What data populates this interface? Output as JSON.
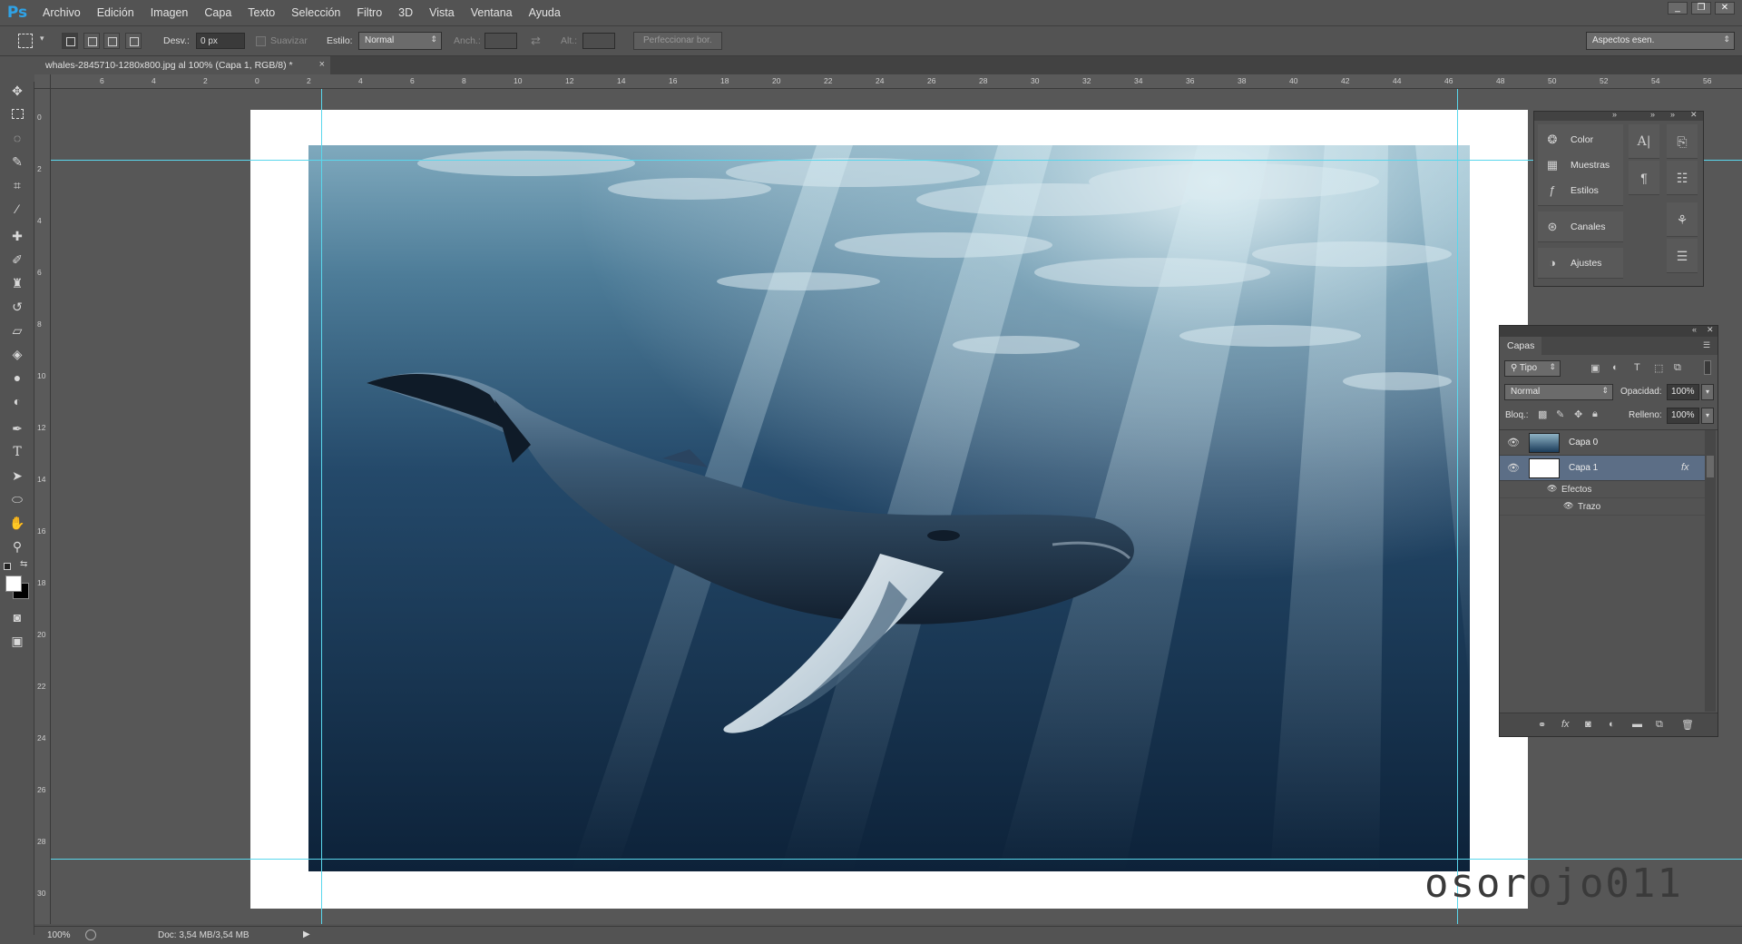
{
  "app": {
    "logo": "Ps"
  },
  "menu": [
    "Archivo",
    "Edición",
    "Imagen",
    "Capa",
    "Texto",
    "Selección",
    "Filtro",
    "3D",
    "Vista",
    "Ventana",
    "Ayuda"
  ],
  "window_controls": [
    "_",
    "❐",
    "✕"
  ],
  "options": {
    "feather_label": "Desv.:",
    "feather_value": "0 px",
    "antialias_label": "Suavizar",
    "style_label": "Estilo:",
    "style_value": "Normal",
    "width_label": "Anch.:",
    "height_label": "Alt.:",
    "refine_button": "Perfeccionar bor.",
    "workspace_value": "Aspectos esen."
  },
  "document": {
    "tab_title": "whales-2845710-1280x800.jpg al 100% (Capa 1, RGB/8) *",
    "close": "×"
  },
  "ruler_top_labels": [
    "6",
    "4",
    "2",
    "0",
    "2",
    "4",
    "6",
    "8",
    "10",
    "12",
    "14",
    "16",
    "18",
    "20",
    "22",
    "24",
    "26",
    "28",
    "30",
    "32",
    "34",
    "36",
    "38",
    "40",
    "42",
    "44",
    "46",
    "48",
    "50",
    "52",
    "54",
    "56"
  ],
  "ruler_left_labels": [
    "0",
    "2",
    "4",
    "6",
    "8",
    "10",
    "12",
    "14",
    "16",
    "18",
    "20",
    "22",
    "24",
    "26",
    "28",
    "30"
  ],
  "watermark": "osorojo011",
  "status": {
    "zoom": "100%",
    "doc_info": "Doc: 3,54 MB/3,54 MB"
  },
  "dock": {
    "items": [
      {
        "label": "Color",
        "icon": "palette-icon"
      },
      {
        "label": "Muestras",
        "icon": "swatches-icon"
      },
      {
        "label": "Estilos",
        "icon": "styles-icon"
      },
      {
        "label": "Canales",
        "icon": "channels-icon"
      },
      {
        "label": "Ajustes",
        "icon": "adjustments-icon"
      }
    ]
  },
  "layers_panel": {
    "tab": "Capas",
    "filter_kind": "Tipo",
    "blend_mode": "Normal",
    "opacity_label": "Opacidad:",
    "opacity_value": "100%",
    "lock_label": "Bloq.:",
    "fill_label": "Relleno:",
    "fill_value": "100%",
    "fx": "fx",
    "layers": [
      {
        "name": "Capa 0",
        "selected": false
      },
      {
        "name": "Capa 1",
        "selected": true
      }
    ],
    "effects_label": "Efectos",
    "stroke_label": "Trazo"
  },
  "colors": {
    "guide": "#5ad7ec",
    "panel": "#535353",
    "selection": "#5c6e86",
    "accent": "#2fa3e7"
  }
}
